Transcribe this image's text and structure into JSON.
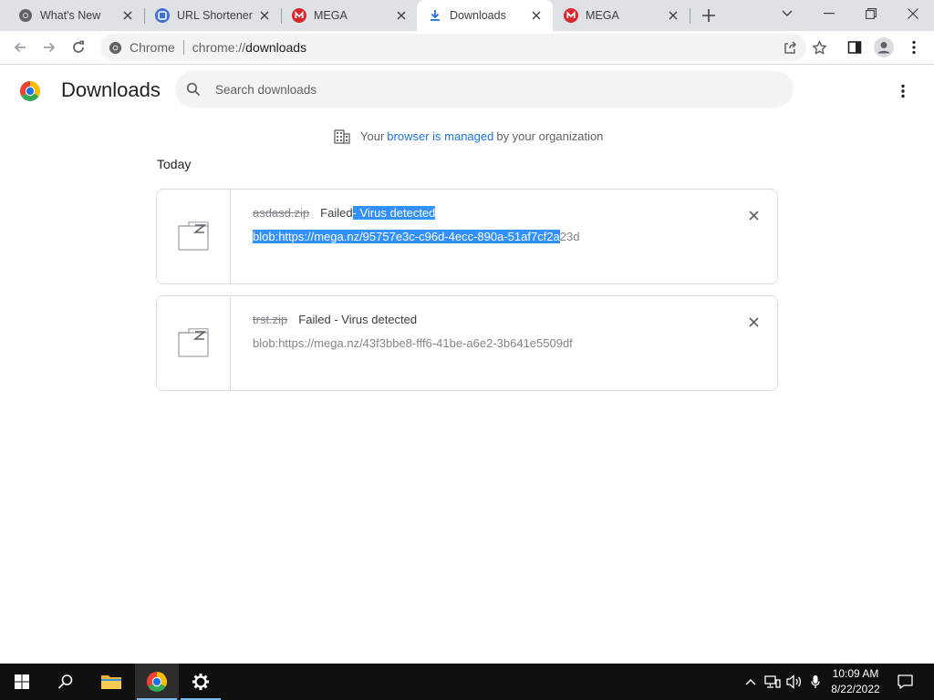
{
  "tabs": [
    {
      "title": "What's New",
      "icon": "chrome-icon",
      "active": false
    },
    {
      "title": "URL Shortener",
      "icon": "url-shortener-icon",
      "active": false
    },
    {
      "title": "MEGA",
      "icon": "mega-icon",
      "active": false
    },
    {
      "title": "Downloads",
      "icon": "download-icon",
      "active": true
    },
    {
      "title": "MEGA",
      "icon": "mega-icon",
      "active": false
    }
  ],
  "omnibox": {
    "site_name": "Chrome",
    "url_prefix": "chrome://",
    "url_host": "downloads"
  },
  "page": {
    "title": "Downloads",
    "search_placeholder": "Search downloads",
    "managed": {
      "prefix": "Your",
      "link": "browser is managed",
      "suffix": "by your organization"
    },
    "section_label": "Today"
  },
  "downloads": [
    {
      "file_name": "asdasd.zip",
      "status_prefix": "Failed",
      "status_selected": " - Virus detected",
      "url_selected": "blob:https://mega.nz/95757e3c-c96d-4ecc-890a-51af7cf2a",
      "url_rest": "23d"
    },
    {
      "file_name": "trst.zip",
      "status": "Failed - Virus detected",
      "url": "blob:https://mega.nz/43f3bbe8-fff6-41be-a6e2-3b641e5509df"
    }
  ],
  "taskbar": {
    "time": "10:09 AM",
    "date": "8/22/2022"
  },
  "colors": {
    "accent": "#1a73e8",
    "selection": "#3390ff",
    "mega_red": "#d9272e",
    "tabstrip": "#dee1e6"
  }
}
